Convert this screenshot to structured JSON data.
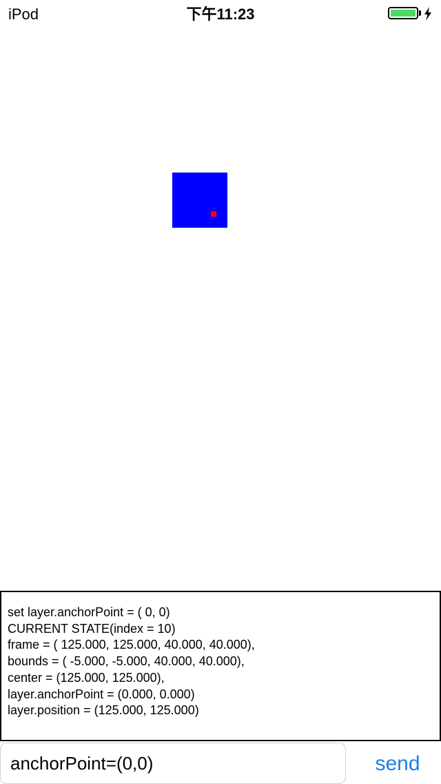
{
  "status_bar": {
    "carrier": "iPod",
    "time": "下午11:23",
    "battery_level": 1.0,
    "battery_color": "#4cd964",
    "charging_icon": "lightning-bolt-icon"
  },
  "canvas": {
    "layer_color": "#0000ff",
    "anchor_marker_color": "#ff0000"
  },
  "log": {
    "lines": [
      "set layer.anchorPoint = ( 0, 0)",
      "CURRENT STATE(index = 10)",
      "frame = ( 125.000, 125.000, 40.000, 40.000),",
      "bounds = ( -5.000, -5.000, 40.000, 40.000),",
      "center = (125.000, 125.000),",
      "layer.anchorPoint = (0.000, 0.000)",
      "layer.position = (125.000, 125.000)"
    ]
  },
  "input": {
    "value": "anchorPoint=(0,0)"
  },
  "send_button": {
    "label": "send",
    "color": "#1a7ff0"
  }
}
